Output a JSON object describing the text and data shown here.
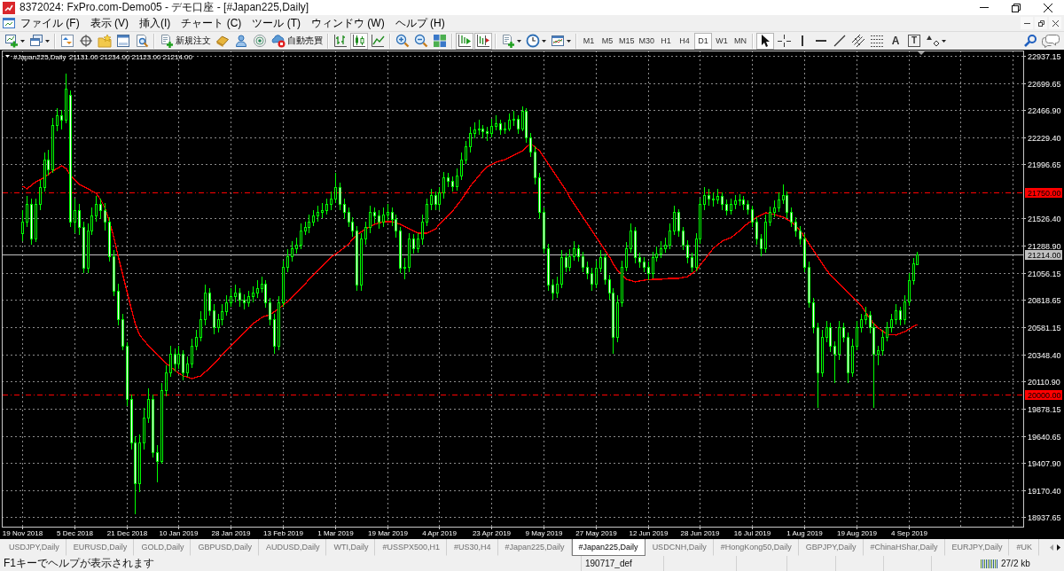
{
  "window": {
    "title": "8372024: FxPro.com-Demo05 - デモ口座 - [#Japan225,Daily]"
  },
  "menu": [
    "ファイル (F)",
    "表示 (V)",
    "挿入(I)",
    "チャート (C)",
    "ツール (T)",
    "ウィンドウ (W)",
    "ヘルプ (H)"
  ],
  "toolbar": {
    "new_order": "新規注文",
    "auto_trading": "自動売買",
    "chart_types": [
      {
        "selected": false
      },
      {
        "selected": true
      },
      {
        "selected": false
      }
    ],
    "chart_scroll": [
      {
        "selected": true
      },
      {
        "selected": true
      }
    ],
    "timeframes": [
      {
        "label": "M1",
        "selected": false
      },
      {
        "label": "M5",
        "selected": false
      },
      {
        "label": "M15",
        "selected": false
      },
      {
        "label": "M30",
        "selected": false
      },
      {
        "label": "H1",
        "selected": false
      },
      {
        "label": "H4",
        "selected": false
      },
      {
        "label": "D1",
        "selected": true
      },
      {
        "label": "W1",
        "selected": false
      },
      {
        "label": "MN",
        "selected": false
      }
    ],
    "drawing_tools": [
      {
        "kind": "icon",
        "selected": true
      },
      {
        "kind": "icon",
        "selected": false
      },
      {
        "kind": "icon",
        "selected": false
      },
      {
        "kind": "icon",
        "selected": false
      },
      {
        "kind": "icon",
        "selected": false
      },
      {
        "kind": "icon",
        "selected": false
      },
      {
        "kind": "icon",
        "selected": false
      },
      {
        "kind": "letter",
        "label": "A",
        "selected": false
      },
      {
        "kind": "boxed-letter",
        "label": "T",
        "selected": false
      },
      {
        "kind": "icon",
        "selected": false
      }
    ]
  },
  "chart": {
    "chart_data": [
      {
        "type": "candlestick",
        "title": "#Japan225,Daily",
        "annotations": [
          "21131.00 21234.00 21123.00 21214.00"
        ],
        "grid": true,
        "ylim": [
          18853,
          22983
        ],
        "yticks": [
          {
            "value": 22937.15,
            "label": "22937.15"
          },
          {
            "value": 22699.65,
            "label": "22699.65"
          },
          {
            "value": 22466.9,
            "label": "22466.90"
          },
          {
            "value": 22229.4,
            "label": "22229.40"
          },
          {
            "value": 21996.65,
            "label": "21996.65"
          },
          {
            "value": 21526.4,
            "label": "21526.40"
          },
          {
            "value": 21288.9,
            "label": "21288.90"
          },
          {
            "value": 21056.15,
            "label": "21056.15"
          },
          {
            "value": 20818.65,
            "label": "20818.65"
          },
          {
            "value": 20581.15,
            "label": "20581.15"
          },
          {
            "value": 20348.4,
            "label": "20348.40"
          },
          {
            "value": 20110.9,
            "label": "20110.90"
          },
          {
            "value": 19878.15,
            "label": "19878.15"
          },
          {
            "value": 19640.65,
            "label": "19640.65"
          },
          {
            "value": 19407.9,
            "label": "19407.90"
          },
          {
            "value": 19170.4,
            "label": "19170.40"
          },
          {
            "value": 18937.65,
            "label": "18937.65"
          }
        ],
        "ref_lines": [
          {
            "axis": "y",
            "value": 21750,
            "label": "21750.00",
            "color": "#ff0000",
            "line_style": "dashdot"
          },
          {
            "axis": "y",
            "value": 21214,
            "label": "21214.00",
            "color": "#c0c0c0",
            "line_style": "solid"
          },
          {
            "axis": "y",
            "value": 20000,
            "label": "20000.00",
            "color": "#ff0000",
            "line_style": "dashdot"
          }
        ],
        "categories": [
          "19 Nov 2018",
          null,
          null,
          null,
          null,
          null,
          null,
          null,
          null,
          null,
          null,
          null,
          "5 Dec 2018",
          null,
          null,
          null,
          null,
          null,
          null,
          null,
          null,
          null,
          null,
          null,
          "21 Dec 2018",
          null,
          null,
          null,
          null,
          null,
          null,
          null,
          null,
          null,
          null,
          null,
          "10 Jan 2019",
          null,
          null,
          null,
          null,
          null,
          null,
          null,
          null,
          null,
          null,
          null,
          "28 Jan 2019",
          null,
          null,
          null,
          null,
          null,
          null,
          null,
          null,
          null,
          null,
          null,
          "13 Feb 2019",
          null,
          null,
          null,
          null,
          null,
          null,
          null,
          null,
          null,
          null,
          null,
          "1 Mar 2019",
          null,
          null,
          null,
          null,
          null,
          null,
          null,
          null,
          null,
          null,
          null,
          "19 Mar 2019",
          null,
          null,
          null,
          null,
          null,
          null,
          null,
          null,
          null,
          null,
          null,
          "4 Apr 2019",
          null,
          null,
          null,
          null,
          null,
          null,
          null,
          null,
          null,
          null,
          null,
          "23 Apr 2019",
          null,
          null,
          null,
          null,
          null,
          null,
          null,
          null,
          null,
          null,
          null,
          "9 May 2019",
          null,
          null,
          null,
          null,
          null,
          null,
          null,
          null,
          null,
          null,
          null,
          "27 May 2019",
          null,
          null,
          null,
          null,
          null,
          null,
          null,
          null,
          null,
          null,
          null,
          "12 Jun 2019",
          null,
          null,
          null,
          null,
          null,
          null,
          null,
          null,
          null,
          null,
          null,
          "28 Jun 2019",
          null,
          null,
          null,
          null,
          null,
          null,
          null,
          null,
          null,
          null,
          null,
          "16 Jul 2019",
          null,
          null,
          null,
          null,
          null,
          null,
          null,
          null,
          null,
          null,
          null,
          "1 Aug 2019",
          null,
          null,
          null,
          null,
          null,
          null,
          null,
          null,
          null,
          null,
          null,
          "19 Aug 2019",
          null,
          null,
          null,
          null,
          null,
          null,
          null,
          null,
          null,
          null,
          null,
          "4 Sep 2019",
          null,
          null
        ],
        "series": [
          {
            "type": "candlestick",
            "color": "#00ff00",
            "ohlc": [
              [
                21400,
                21600,
                21330,
                21500
              ],
              [
                21500,
                21720,
                21450,
                21650
              ],
              [
                21650,
                21700,
                21300,
                21350
              ],
              [
                21350,
                21700,
                21320,
                21650
              ],
              [
                21650,
                21860,
                21600,
                21800
              ],
              [
                21800,
                22100,
                21760,
                22040
              ],
              [
                22040,
                22120,
                21900,
                21950
              ],
              [
                21950,
                22400,
                21920,
                22340
              ],
              [
                22340,
                22480,
                22280,
                22420
              ],
              [
                22420,
                22470,
                22300,
                22380
              ],
              [
                22380,
                22780,
                22350,
                22650
              ],
              [
                22600,
                22640,
                21450,
                21500
              ],
              [
                21500,
                21700,
                21400,
                21600
              ],
              [
                21600,
                21650,
                21380,
                21450
              ],
              [
                21450,
                21500,
                21050,
                21100
              ],
              [
                21100,
                21480,
                21050,
                21420
              ],
              [
                21420,
                21620,
                21380,
                21550
              ],
              [
                21550,
                21720,
                21500,
                21650
              ],
              [
                21650,
                21700,
                21520,
                21600
              ],
              [
                21600,
                21660,
                21420,
                21500
              ],
              [
                21500,
                21540,
                21150,
                21200
              ],
              [
                21200,
                21250,
                20850,
                20900
              ],
              [
                20900,
                20960,
                20600,
                20650
              ],
              [
                20650,
                20700,
                20380,
                20420
              ],
              [
                20420,
                20450,
                19900,
                19960
              ],
              [
                19960,
                20000,
                19520,
                19580
              ],
              [
                19580,
                19640,
                18960,
                19230
              ],
              [
                19230,
                19650,
                19150,
                19580
              ],
              [
                19580,
                19880,
                19520,
                19800
              ],
              [
                19800,
                20050,
                19750,
                19960
              ],
              [
                19960,
                20000,
                19450,
                19500
              ],
              [
                19500,
                19560,
                19240,
                19420
              ],
              [
                19420,
                20100,
                19400,
                20040
              ],
              [
                20040,
                20250,
                19980,
                20190
              ],
              [
                20190,
                20420,
                20150,
                20350
              ],
              [
                20350,
                20400,
                20200,
                20270
              ],
              [
                20270,
                20420,
                20220,
                20350
              ],
              [
                20350,
                20380,
                20120,
                20190
              ],
              [
                20190,
                20330,
                20150,
                20270
              ],
              [
                20270,
                20480,
                20230,
                20420
              ],
              [
                20420,
                20560,
                20380,
                20500
              ],
              [
                20500,
                20720,
                20460,
                20650
              ],
              [
                20650,
                20950,
                20600,
                20880
              ],
              [
                20880,
                20920,
                20680,
                20730
              ],
              [
                20730,
                20780,
                20520,
                20580
              ],
              [
                20580,
                20700,
                20540,
                20650
              ],
              [
                20650,
                20780,
                20600,
                20720
              ],
              [
                20720,
                20860,
                20680,
                20800
              ],
              [
                20800,
                20920,
                20760,
                20850
              ],
              [
                20850,
                20950,
                20800,
                20880
              ],
              [
                20880,
                20920,
                20760,
                20820
              ],
              [
                20820,
                20870,
                20740,
                20800
              ],
              [
                20800,
                20900,
                20760,
                20850
              ],
              [
                20850,
                20940,
                20800,
                20880
              ],
              [
                20880,
                20990,
                20840,
                20920
              ],
              [
                20920,
                21020,
                20880,
                20960
              ],
              [
                20960,
                20990,
                20750,
                20800
              ],
              [
                20800,
                20840,
                20600,
                20650
              ],
              [
                20650,
                20700,
                20350,
                20420
              ],
              [
                20420,
                20850,
                20380,
                20800
              ],
              [
                20800,
                21160,
                20760,
                21110
              ],
              [
                21110,
                21260,
                21060,
                21200
              ],
              [
                21200,
                21330,
                21150,
                21270
              ],
              [
                21270,
                21360,
                21220,
                21300
              ],
              [
                21300,
                21480,
                21260,
                21420
              ],
              [
                21420,
                21500,
                21380,
                21450
              ],
              [
                21450,
                21560,
                21400,
                21500
              ],
              [
                21500,
                21600,
                21460,
                21550
              ],
              [
                21550,
                21640,
                21500,
                21580
              ],
              [
                21580,
                21660,
                21530,
                21600
              ],
              [
                21600,
                21700,
                21560,
                21650
              ],
              [
                21650,
                21760,
                21600,
                21700
              ],
              [
                21700,
                21920,
                21660,
                21800
              ],
              [
                21800,
                21840,
                21600,
                21650
              ],
              [
                21650,
                21700,
                21520,
                21580
              ],
              [
                21580,
                21620,
                21450,
                21500
              ],
              [
                21500,
                21540,
                21370,
                21420
              ],
              [
                21420,
                21460,
                20900,
                20950
              ],
              [
                20950,
                21400,
                20900,
                21350
              ],
              [
                21350,
                21500,
                21300,
                21450
              ],
              [
                21450,
                21640,
                21400,
                21580
              ],
              [
                21580,
                21620,
                21480,
                21550
              ],
              [
                21550,
                21600,
                21440,
                21500
              ],
              [
                21500,
                21620,
                21450,
                21560
              ],
              [
                21560,
                21650,
                21510,
                21580
              ],
              [
                21580,
                21620,
                21460,
                21520
              ],
              [
                21520,
                21560,
                21360,
                21420
              ],
              [
                21420,
                21450,
                21050,
                21100
              ],
              [
                21100,
                21180,
                21000,
                21110
              ],
              [
                21110,
                21400,
                21060,
                21350
              ],
              [
                21350,
                21390,
                21220,
                21270
              ],
              [
                21270,
                21400,
                21230,
                21350
              ],
              [
                21350,
                21560,
                21300,
                21500
              ],
              [
                21500,
                21700,
                21460,
                21650
              ],
              [
                21650,
                21780,
                21600,
                21730
              ],
              [
                21730,
                21760,
                21600,
                21650
              ],
              [
                21650,
                21800,
                21600,
                21750
              ],
              [
                21750,
                21930,
                21700,
                21880
              ],
              [
                21880,
                21920,
                21800,
                21850
              ],
              [
                21850,
                21890,
                21760,
                21810
              ],
              [
                21810,
                21960,
                21770,
                21900
              ],
              [
                21900,
                22100,
                21860,
                22040
              ],
              [
                22040,
                22200,
                22000,
                22150
              ],
              [
                22150,
                22320,
                22100,
                22270
              ],
              [
                22270,
                22360,
                22220,
                22300
              ],
              [
                22300,
                22380,
                22250,
                22310
              ],
              [
                22310,
                22340,
                22220,
                22280
              ],
              [
                22280,
                22320,
                22200,
                22270
              ],
              [
                22270,
                22390,
                22230,
                22330
              ],
              [
                22330,
                22420,
                22290,
                22350
              ],
              [
                22350,
                22380,
                22250,
                22300
              ],
              [
                22300,
                22360,
                22260,
                22310
              ],
              [
                22310,
                22440,
                22280,
                22380
              ],
              [
                22380,
                22460,
                22330,
                22390
              ],
              [
                22390,
                22420,
                22260,
                22310
              ],
              [
                22310,
                22500,
                22280,
                22460
              ],
              [
                22460,
                22480,
                22180,
                22230
              ],
              [
                22230,
                22270,
                22060,
                22110
              ],
              [
                22110,
                22150,
                21820,
                21880
              ],
              [
                21880,
                21920,
                21520,
                21580
              ],
              [
                21580,
                21620,
                21220,
                21270
              ],
              [
                21270,
                21310,
                20900,
                20950
              ],
              [
                20950,
                21000,
                20820,
                20880
              ],
              [
                20880,
                21020,
                20840,
                20960
              ],
              [
                20960,
                21250,
                20920,
                21190
              ],
              [
                21190,
                21230,
                21060,
                21110
              ],
              [
                21110,
                21260,
                21070,
                21200
              ],
              [
                21200,
                21330,
                21160,
                21270
              ],
              [
                21270,
                21300,
                21150,
                21200
              ],
              [
                21200,
                21240,
                21060,
                21110
              ],
              [
                21110,
                21150,
                21000,
                21050
              ],
              [
                21050,
                21100,
                20900,
                20960
              ],
              [
                20960,
                21160,
                20920,
                21100
              ],
              [
                21100,
                21250,
                21060,
                21190
              ],
              [
                21190,
                21220,
                20950,
                21000
              ],
              [
                21000,
                21040,
                20820,
                20880
              ],
              [
                20880,
                20920,
                20350,
                20500
              ],
              [
                20500,
                20860,
                20450,
                20800
              ],
              [
                20800,
                21160,
                20760,
                21110
              ],
              [
                21110,
                21320,
                21070,
                21270
              ],
              [
                21270,
                21480,
                21230,
                21420
              ],
              [
                21420,
                21450,
                21140,
                21190
              ],
              [
                21190,
                21230,
                21100,
                21150
              ],
              [
                21150,
                21190,
                21060,
                21110
              ],
              [
                21110,
                21150,
                20990,
                21050
              ],
              [
                21050,
                21240,
                21010,
                21190
              ],
              [
                21190,
                21280,
                21150,
                21220
              ],
              [
                21220,
                21330,
                21180,
                21270
              ],
              [
                21270,
                21360,
                21230,
                21300
              ],
              [
                21300,
                21480,
                21260,
                21420
              ],
              [
                21420,
                21640,
                21380,
                21580
              ],
              [
                21580,
                21610,
                21370,
                21420
              ],
              [
                21420,
                21450,
                21250,
                21300
              ],
              [
                21300,
                21340,
                21140,
                21190
              ],
              [
                21190,
                21230,
                21060,
                21110
              ],
              [
                21110,
                21400,
                21070,
                21350
              ],
              [
                21350,
                21700,
                21310,
                21650
              ],
              [
                21650,
                21800,
                21600,
                21730
              ],
              [
                21730,
                21780,
                21640,
                21700
              ],
              [
                21700,
                21750,
                21630,
                21690
              ],
              [
                21690,
                21780,
                21650,
                21720
              ],
              [
                21720,
                21750,
                21600,
                21650
              ],
              [
                21650,
                21690,
                21550,
                21600
              ],
              [
                21600,
                21700,
                21560,
                21650
              ],
              [
                21650,
                21730,
                21610,
                21680
              ],
              [
                21680,
                21740,
                21640,
                21690
              ],
              [
                21690,
                21720,
                21600,
                21650
              ],
              [
                21650,
                21680,
                21560,
                21610
              ],
              [
                21610,
                21640,
                21450,
                21500
              ],
              [
                21500,
                21540,
                21300,
                21350
              ],
              [
                21350,
                21390,
                21200,
                21270
              ],
              [
                21270,
                21560,
                21230,
                21500
              ],
              [
                21500,
                21630,
                21460,
                21580
              ],
              [
                21580,
                21680,
                21540,
                21620
              ],
              [
                21620,
                21750,
                21580,
                21690
              ],
              [
                21690,
                21820,
                21650,
                21730
              ],
              [
                21730,
                21760,
                21530,
                21580
              ],
              [
                21580,
                21620,
                21450,
                21500
              ],
              [
                21500,
                21540,
                21370,
                21420
              ],
              [
                21420,
                21460,
                21300,
                21350
              ],
              [
                21350,
                21390,
                21060,
                21110
              ],
              [
                21110,
                21150,
                20750,
                20800
              ],
              [
                20800,
                20840,
                20530,
                20580
              ],
              [
                20580,
                20620,
                19880,
                20190
              ],
              [
                20190,
                20560,
                20150,
                20500
              ],
              [
                20500,
                20640,
                20450,
                20580
              ],
              [
                20580,
                20620,
                20370,
                20420
              ],
              [
                20420,
                20460,
                20100,
                20350
              ],
              [
                20350,
                20640,
                20300,
                20580
              ],
              [
                20580,
                20620,
                20450,
                20500
              ],
              [
                20500,
                20540,
                20100,
                20190
              ],
              [
                20190,
                20480,
                20150,
                20420
              ],
              [
                20420,
                20640,
                20380,
                20580
              ],
              [
                20580,
                20700,
                20540,
                20650
              ],
              [
                20650,
                20760,
                20610,
                20690
              ],
              [
                20690,
                20720,
                20530,
                20580
              ],
              [
                20580,
                20620,
                19880,
                20350
              ],
              [
                20350,
                20420,
                20250,
                20380
              ],
              [
                20380,
                20560,
                20340,
                20500
              ],
              [
                20500,
                20630,
                20460,
                20580
              ],
              [
                20580,
                20700,
                20540,
                20650
              ],
              [
                20650,
                20780,
                20610,
                20730
              ],
              [
                20730,
                20760,
                20600,
                20650
              ],
              [
                20650,
                20860,
                20610,
                20810
              ],
              [
                20810,
                21050,
                20770,
                20990
              ],
              [
                20990,
                21180,
                20950,
                21140
              ],
              [
                21131,
                21234,
                21123,
                21214
              ]
            ]
          },
          {
            "type": "line",
            "color": "#ff0000",
            "values": [
              21807,
              21784,
              21815,
              21845,
              21864,
              21883,
              21910,
              21937,
              21960,
              21983,
              21960,
              21899,
              21860,
              21822,
              21803,
              21784,
              21765,
              21745,
              21691,
              21614,
              21499,
              21360,
              21191,
              21037,
              20884,
              20730,
              20615,
              20515,
              20468,
              20422,
              20383,
              20345,
              20307,
              20269,
              20238,
              20207,
              20184,
              20161,
              20150,
              20138,
              20150,
              20161,
              20195,
              20230,
              20268,
              20307,
              20345,
              20384,
              20422,
              20461,
              20500,
              20538,
              20576,
              20615,
              20641,
              20668,
              20680,
              20691,
              20718,
              20745,
              20776,
              20807,
              20845,
              20884,
              20922,
              20961,
              20999,
              21037,
              21076,
              21114,
              21152,
              21191,
              21218,
              21245,
              21276,
              21307,
              21345,
              21384,
              21410,
              21437,
              21456,
              21476,
              21488,
              21499,
              21499,
              21499,
              21488,
              21476,
              21456,
              21437,
              21418,
              21399,
              21399,
              21399,
              21418,
              21437,
              21476,
              21514,
              21552,
              21591,
              21641,
              21691,
              21749,
              21807,
              21853,
              21899,
              21937,
              21976,
              21995,
              22014,
              22026,
              22037,
              22056,
              22076,
              22095,
              22114,
              22145,
              22176,
              22145,
              22114,
              22057,
              21999,
              21941,
              21883,
              21826,
              21768,
              21710,
              21653,
              21595,
              21537,
              21480,
              21422,
              21365,
              21307,
              21249,
              21191,
              21134,
              21076,
              21037,
              20999,
              20988,
              20976,
              20984,
              20991,
              20995,
              20999,
              20999,
              20999,
              21003,
              21007,
              21007,
              21007,
              21015,
              21022,
              21049,
              21076,
              21122,
              21168,
              21218,
              21268,
              21299,
              21330,
              21345,
              21360,
              21391,
              21422,
              21453,
              21484,
              21510,
              21537,
              21556,
              21576,
              21568,
              21560,
              21548,
              21537,
              21518,
              21499,
              21460,
              21422,
              21364,
              21307,
              21249,
              21191,
              21134,
              21076,
              21037,
              20999,
              20960,
              20922,
              20884,
              20845,
              20807,
              20768,
              20710,
              20653,
              20614,
              20576,
              20549,
              20522,
              20518,
              20515,
              20530,
              20545,
              20568,
              20591,
              20605
            ]
          }
        ]
      }
    ]
  },
  "chart_tabs": [
    {
      "label": "USDJPY,Daily",
      "selected": false
    },
    {
      "label": "EURUSD,Daily",
      "selected": false
    },
    {
      "label": "GOLD,Daily",
      "selected": false
    },
    {
      "label": "GBPUSD,Daily",
      "selected": false
    },
    {
      "label": "AUDUSD,Daily",
      "selected": false
    },
    {
      "label": "WTI,Daily",
      "selected": false
    },
    {
      "label": "#USSPX500,H1",
      "selected": false
    },
    {
      "label": "#US30,H4",
      "selected": false
    },
    {
      "label": "#Japan225,Daily",
      "selected": false
    },
    {
      "label": "#Japan225,Daily",
      "selected": true
    },
    {
      "label": "USDCNH,Daily",
      "selected": false
    },
    {
      "label": "#HongKong50,Daily",
      "selected": false
    },
    {
      "label": "GBPJPY,Daily",
      "selected": false
    },
    {
      "label": "#ChinaHShar,Daily",
      "selected": false
    },
    {
      "label": "EURJPY,Daily",
      "selected": false
    },
    {
      "label": "#UK",
      "selected": false
    }
  ],
  "status_bar": {
    "help": "F1キーでヘルプが表示されます",
    "profile": "190717_def",
    "traffic": "27/2 kb"
  }
}
